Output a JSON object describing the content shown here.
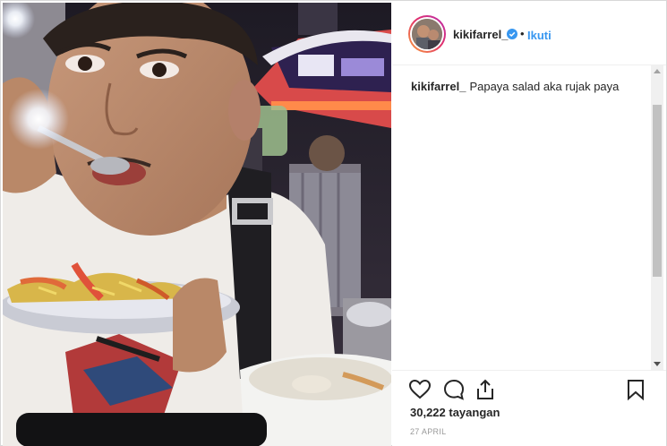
{
  "post": {
    "username": "kikifarrel_",
    "follow_separator": "•",
    "follow_label": "Ikuti",
    "caption_user": "kikifarrel_",
    "caption_text": "Papaya salad aka rujak paya",
    "views": "30,222 tayangan",
    "date": "27 APRIL"
  },
  "icons": {
    "verified": "verified-badge-icon",
    "like": "heart-icon",
    "comment": "comment-bubble-icon",
    "share": "share-icon",
    "save": "bookmark-icon"
  },
  "colors": {
    "link": "#3897f0",
    "text": "#262626",
    "muted": "#999999",
    "verified": "#3897f0"
  }
}
